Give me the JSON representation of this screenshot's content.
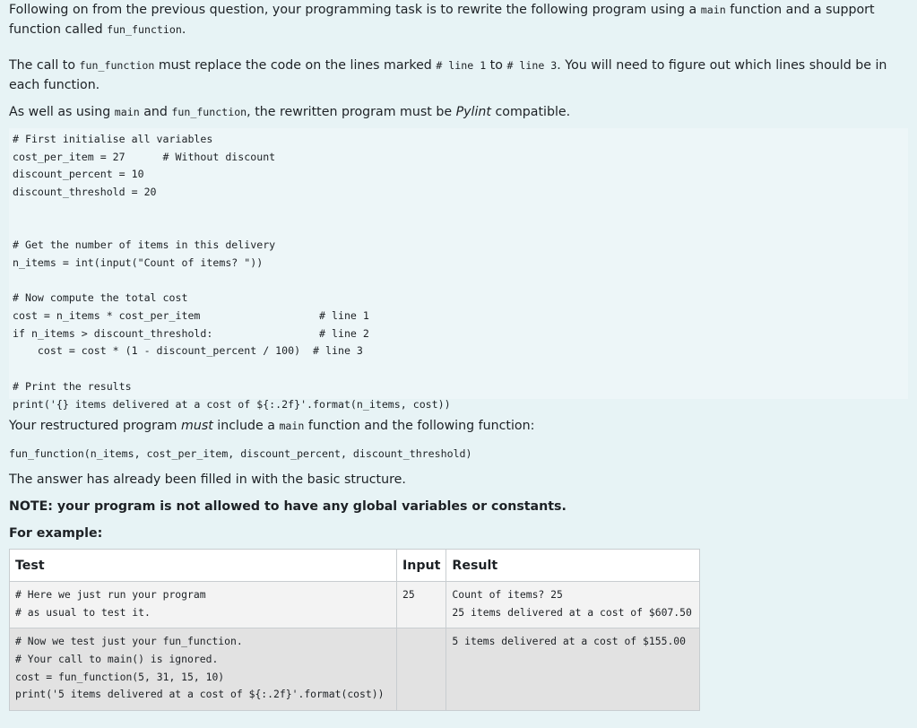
{
  "intro": {
    "p1_a": "Following on from the previous question, your programming task is to rewrite the following program using a ",
    "p1_code1": "main",
    "p1_b": " function and a support function called ",
    "p1_code2": "fun_function",
    "p1_c": ".",
    "p2_a": "The call to ",
    "p2_code1": "fun_function",
    "p2_b": " must replace the code on the lines marked ",
    "p2_code2": "# line 1",
    "p2_c": " to ",
    "p2_code3": "# line 3",
    "p2_d": ". You will need to figure out which lines should be in each function.",
    "p3_a": "As well as using ",
    "p3_code1": "main",
    "p3_b": " and ",
    "p3_code2": "fun_function",
    "p3_c": ", the rewritten program must be ",
    "p3_em": "Pylint",
    "p3_d": " compatible."
  },
  "program_code": "# First initialise all variables\ncost_per_item = 27      # Without discount\ndiscount_percent = 10\ndiscount_threshold = 20\n\n\n# Get the number of items in this delivery\nn_items = int(input(\"Count of items? \"))\n\n# Now compute the total cost\ncost = n_items * cost_per_item                   # line 1\nif n_items > discount_threshold:                 # line 2\n    cost = cost * (1 - discount_percent / 100)  # line 3\n\n# Print the results\nprint('{} items delivered at a cost of ${:.2f}'.format(n_items, cost))",
  "restructure": {
    "a": "Your restructured program ",
    "em": "must",
    "b": " include a ",
    "code": "main",
    "c": " function and the following function:"
  },
  "signature": "fun_function(n_items, cost_per_item, discount_percent, discount_threshold)",
  "basic_structure": "The answer has already been filled in with the basic structure.",
  "note": "NOTE: your program is not allowed to have any global variables or constants.",
  "for_example": "For example:",
  "table": {
    "headers": {
      "test": "Test",
      "input": "Input",
      "result": "Result"
    },
    "rows": [
      {
        "test": "# Here we just run your program\n# as usual to test it.",
        "input": "25",
        "result": "Count of items? 25\n25 items delivered at a cost of $607.50"
      },
      {
        "test": "# Now we test just your fun_function.\n# Your call to main() is ignored.\ncost = fun_function(5, 31, 15, 10)\nprint('5 items delivered at a cost of ${:.2f}'.format(cost))",
        "input": "",
        "result": "5 items delivered at a cost of $155.00"
      }
    ]
  }
}
